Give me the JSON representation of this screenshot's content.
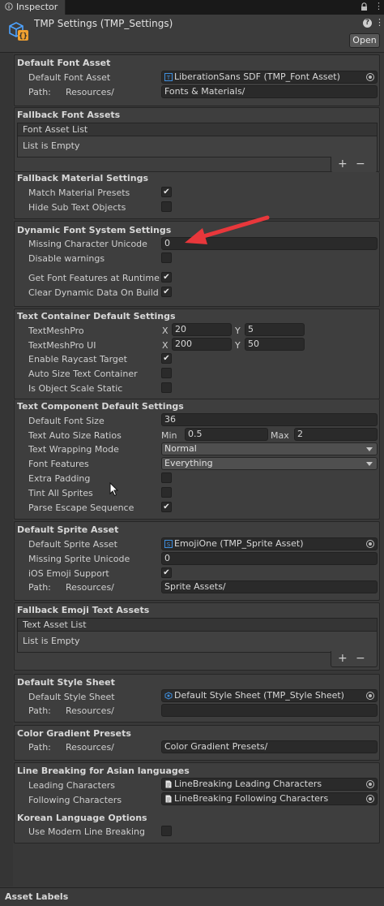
{
  "tab": {
    "label": "Inspector",
    "lock_icon": "lock-icon",
    "menu_icon": "kebab-menu-icon"
  },
  "header": {
    "title": "TMP Settings (TMP_Settings)",
    "open_label": "Open",
    "help_icon": "help-icon",
    "menu_icon": "kebab-menu-icon"
  },
  "default_font_asset": {
    "heading": "Default Font Asset",
    "font_label": "Default Font Asset",
    "font_value": "LiberationSans SDF (TMP_Font Asset)",
    "path_label": "Path:",
    "path_prefix": "Resources/",
    "path_value": "Fonts & Materials/"
  },
  "fallback_font_assets": {
    "heading": "Fallback Font Assets",
    "list_header": "Font Asset List",
    "empty_text": "List is Empty",
    "add": "+",
    "remove": "−"
  },
  "fallback_material": {
    "heading": "Fallback Material Settings",
    "match_label": "Match Material Presets",
    "match_checked": true,
    "hide_label": "Hide Sub Text Objects",
    "hide_checked": false
  },
  "dynamic_font": {
    "heading": "Dynamic Font System Settings",
    "missing_label": "Missing Character Unicode",
    "missing_value": "0",
    "disable_label": "Disable warnings",
    "disable_checked": false,
    "features_label": "Get Font Features at Runtime",
    "features_checked": true,
    "clear_label": "Clear Dynamic Data On Build",
    "clear_checked": true
  },
  "text_container": {
    "heading": "Text Container Default Settings",
    "tmp_label": "TextMeshPro",
    "tmp_x": "20",
    "tmp_y": "5",
    "tmpui_label": "TextMeshPro UI",
    "tmpui_x": "200",
    "tmpui_y": "50",
    "x_label": "X",
    "y_label": "Y",
    "raycast_label": "Enable Raycast Target",
    "raycast_checked": true,
    "autosize_label": "Auto Size Text Container",
    "autosize_checked": false,
    "scale_label": "Is Object Scale Static",
    "scale_checked": false
  },
  "text_component": {
    "heading": "Text Component Default Settings",
    "size_label": "Default Font Size",
    "size_value": "36",
    "ratio_label": "Text Auto Size Ratios",
    "min_label": "Min",
    "min_value": "0.5",
    "max_label": "Max",
    "max_value": "2",
    "wrap_label": "Text Wrapping Mode",
    "wrap_value": "Normal",
    "features_label": "Font Features",
    "features_value": "Everything",
    "padding_label": "Extra Padding",
    "padding_checked": false,
    "tint_label": "Tint All Sprites",
    "tint_checked": false,
    "escape_label": "Parse Escape Sequence",
    "escape_checked": true
  },
  "default_sprite": {
    "heading": "Default Sprite Asset",
    "sprite_label": "Default Sprite Asset",
    "sprite_value": "EmojiOne (TMP_Sprite Asset)",
    "missing_label": "Missing Sprite Unicode",
    "missing_value": "0",
    "ios_label": "iOS Emoji Support",
    "ios_checked": true,
    "path_label": "Path:",
    "path_prefix": "Resources/",
    "path_value": "Sprite Assets/"
  },
  "fallback_emoji": {
    "heading": "Fallback Emoji Text Assets",
    "list_header": "Text Asset List",
    "empty_text": "List is Empty",
    "add": "+",
    "remove": "−"
  },
  "style_sheet": {
    "heading": "Default Style Sheet",
    "sheet_label": "Default Style Sheet",
    "sheet_value": "Default Style Sheet (TMP_Style Sheet)",
    "path_label": "Path:",
    "path_prefix": "Resources/",
    "path_value": ""
  },
  "color_gradient": {
    "heading": "Color Gradient Presets",
    "path_label": "Path:",
    "path_prefix": "Resources/",
    "path_value": "Color Gradient Presets/"
  },
  "line_breaking": {
    "heading": "Line Breaking for Asian languages",
    "leading_label": "Leading Characters",
    "leading_value": "LineBreaking Leading Characters",
    "following_label": "Following Characters",
    "following_value": "LineBreaking Following Characters"
  },
  "korean": {
    "heading": "Korean Language Options",
    "modern_label": "Use Modern Line Breaking",
    "modern_checked": false
  },
  "footer": {
    "asset_labels": "Asset Labels"
  },
  "colors": {
    "background": "#383838",
    "section": "#3e3e3e",
    "field": "#2a2a2a",
    "annotation_arrow": "#e8373b",
    "asset_icon": "#3e8ede"
  }
}
